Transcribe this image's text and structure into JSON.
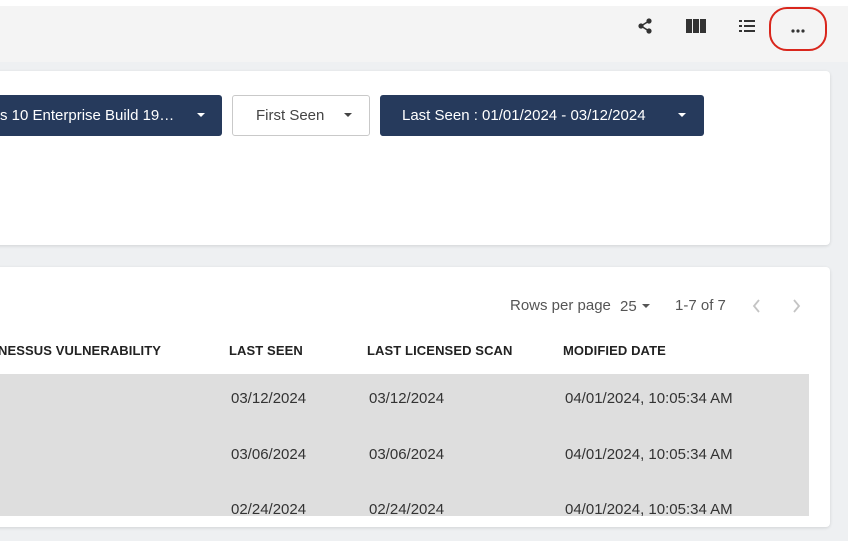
{
  "toolbar": {
    "icons": [
      "share-icon",
      "columns-icon",
      "list-icon",
      "more-icon"
    ],
    "highlight_color": "#d9261c"
  },
  "filters": {
    "os_filter": "s 10 Enterprise Build 19…",
    "first_seen": "First Seen",
    "last_seen": "Last Seen : 01/01/2024 - 03/12/2024",
    "accent": "#263a5c"
  },
  "pager": {
    "rows_per_page_label": "Rows per page",
    "rows_per_page_value": "25",
    "range": "1-7 of 7"
  },
  "table": {
    "columns": [
      "NESSUS VULNERABILITY",
      "LAST SEEN",
      "LAST LICENSED SCAN",
      "MODIFIED DATE"
    ],
    "rows": [
      {
        "last_seen": "03/12/2024",
        "last_licensed_scan": "03/12/2024",
        "modified": "04/01/2024, 10:05:34 AM"
      },
      {
        "last_seen": "03/06/2024",
        "last_licensed_scan": "03/06/2024",
        "modified": "04/01/2024, 10:05:34 AM"
      },
      {
        "last_seen": "02/24/2024",
        "last_licensed_scan": "02/24/2024",
        "modified": "04/01/2024, 10:05:34 AM"
      }
    ]
  }
}
